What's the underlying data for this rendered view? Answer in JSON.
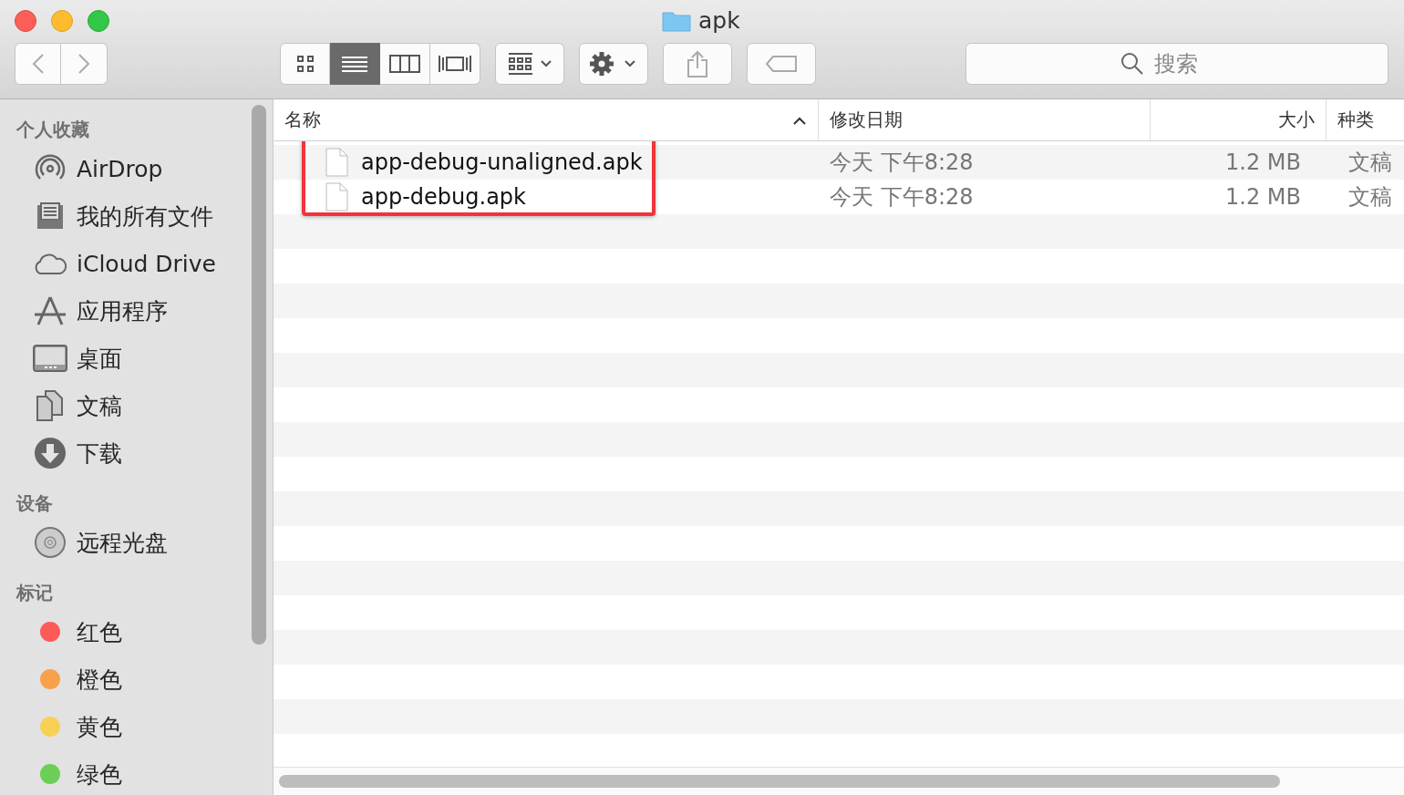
{
  "window": {
    "title": "apk"
  },
  "toolbar": {
    "views": [
      {
        "kind": "icons",
        "selected": false
      },
      {
        "kind": "list",
        "selected": true
      },
      {
        "kind": "columns",
        "selected": false
      },
      {
        "kind": "gallery",
        "selected": false
      }
    ],
    "search": {
      "placeholder": "搜索"
    }
  },
  "sidebar": {
    "sections": [
      {
        "heading": "个人收藏",
        "items": [
          {
            "label": "AirDrop",
            "kind": "airdrop"
          },
          {
            "label": "我的所有文件",
            "kind": "tray"
          },
          {
            "label": "iCloud Drive",
            "kind": "cloud"
          },
          {
            "label": "应用程序",
            "kind": "apps"
          },
          {
            "label": "桌面",
            "kind": "desktop"
          },
          {
            "label": "文稿",
            "kind": "docs"
          },
          {
            "label": "下载",
            "kind": "download"
          }
        ]
      },
      {
        "heading": "设备",
        "items": [
          {
            "label": "远程光盘",
            "kind": "disc"
          }
        ]
      },
      {
        "heading": "标记",
        "items": [
          {
            "label": "红色",
            "kind": "tag",
            "color": "#fc5b57"
          },
          {
            "label": "橙色",
            "kind": "tag",
            "color": "#f7a24a"
          },
          {
            "label": "黄色",
            "kind": "tag",
            "color": "#f8d054"
          },
          {
            "label": "绿色",
            "kind": "tag",
            "color": "#6bcf55"
          }
        ]
      }
    ]
  },
  "table": {
    "columns": [
      {
        "label": "名称",
        "sorted": true
      },
      {
        "label": "修改日期",
        "sorted": false
      },
      {
        "label": "大小",
        "sorted": false
      },
      {
        "label": "种类",
        "sorted": false
      }
    ],
    "rows": [
      {
        "name": "app-debug-unaligned.apk",
        "modified": "今天 下午8:28",
        "size": "1.2 MB",
        "kind": "文稿",
        "highlighted": true
      },
      {
        "name": "app-debug.apk",
        "modified": "今天 下午8:28",
        "size": "1.2 MB",
        "kind": "文稿",
        "highlighted": true
      }
    ]
  }
}
